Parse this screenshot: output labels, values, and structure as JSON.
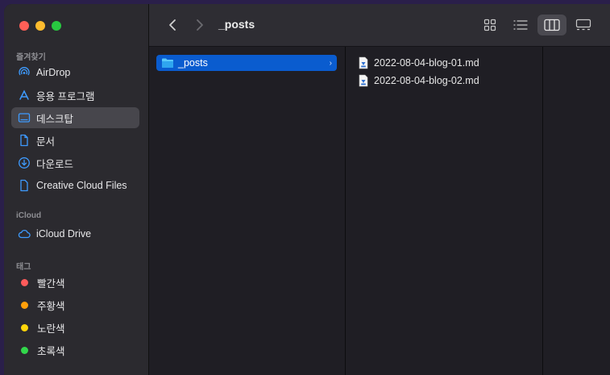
{
  "window": {
    "traffic_lights": {
      "close": "#ff5f57",
      "minimize": "#febc2e",
      "zoom": "#28c840"
    }
  },
  "sidebar": {
    "favorites_title": "즐겨찾기",
    "favorites": [
      {
        "label": "AirDrop",
        "icon": "airdrop-icon"
      },
      {
        "label": "응용 프로그램",
        "icon": "applications-icon"
      },
      {
        "label": "데스크탑",
        "icon": "desktop-icon",
        "selected": true
      },
      {
        "label": "문서",
        "icon": "document-icon"
      },
      {
        "label": "다운로드",
        "icon": "download-icon"
      },
      {
        "label": "Creative Cloud Files",
        "icon": "file-icon"
      }
    ],
    "icloud_title": "iCloud",
    "icloud": [
      {
        "label": "iCloud Drive",
        "icon": "cloud-icon"
      }
    ],
    "tags_title": "태그",
    "tags": [
      {
        "label": "빨간색",
        "color": "#ff5b5b"
      },
      {
        "label": "주황색",
        "color": "#ff9f0a"
      },
      {
        "label": "노란색",
        "color": "#ffd60a"
      },
      {
        "label": "초록색",
        "color": "#32d74b"
      }
    ]
  },
  "toolbar": {
    "title": "_posts",
    "accent": "#0a5ccf"
  },
  "columns": {
    "first": [
      {
        "label": "_posts",
        "icon": "folder-icon",
        "selected": true
      }
    ],
    "second": [
      {
        "label": "2022-08-04-blog-01.md",
        "icon": "markdown-file-icon"
      },
      {
        "label": "2022-08-04-blog-02.md",
        "icon": "markdown-file-icon"
      }
    ]
  }
}
